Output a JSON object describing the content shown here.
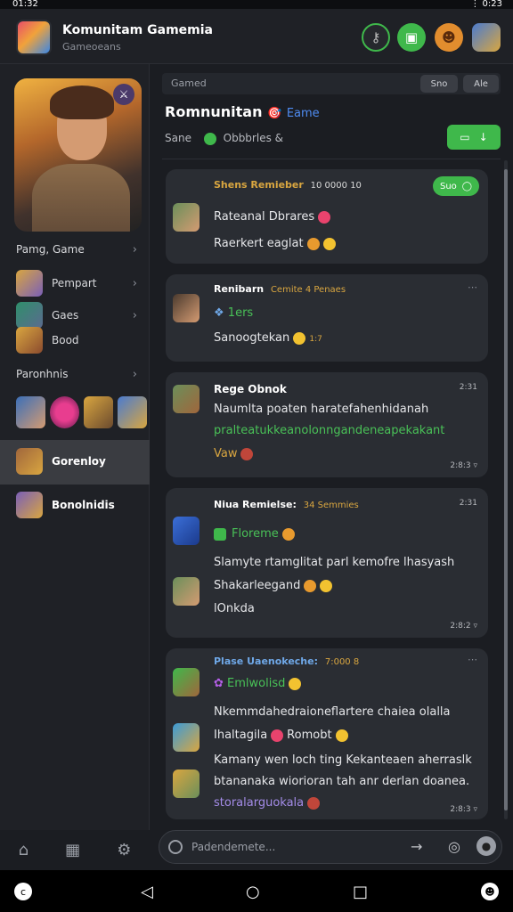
{
  "status": {
    "time": "01:32",
    "right": "⋮ 0:23"
  },
  "app": {
    "title": "Komunitam Gamemia",
    "subtitle": "Gameoeans"
  },
  "header_buttons": [
    "lock-icon",
    "video-icon",
    "face-icon",
    "avatar"
  ],
  "sidebar": {
    "rows": [
      {
        "label": "Pamg, Game",
        "chevron": true
      },
      {
        "label": "Pempart",
        "chevron": true
      },
      {
        "label": "Gaes",
        "chevron": true
      },
      {
        "label": "Bood",
        "chevron": false
      },
      {
        "label": "Paronhnis",
        "chevron": true
      },
      {
        "label": "Gorenloy"
      },
      {
        "label": "Bonolnidis"
      }
    ]
  },
  "main": {
    "search_label": "Gamed",
    "search_pill": "Sno",
    "search_pill2": "Ale",
    "title": "Romnunitan",
    "title_tag": "Eame",
    "subtitle": "Sane",
    "subtitle2": "Obbbrles &",
    "action": "",
    "composer_placeholder": "Padendemete..."
  },
  "messages": [
    {
      "head": "Shens Remieber",
      "meta": "10 0000 10",
      "lines": [
        "Rateanal Dbrares",
        "Raerkert eaglat"
      ],
      "pill": "Suo",
      "time": ""
    },
    {
      "head": "Renibarn",
      "meta": "Cemite 4 Penaes",
      "lines": [
        "1ers",
        "Sanoogtekan"
      ],
      "time": "1:7"
    },
    {
      "head": "Rege Obnok",
      "meta": "",
      "lines": [
        "Naumlta poaten haratefahenhidanah",
        "pralteatukkeanolonngandeneapekakant",
        "Vaw"
      ],
      "time": "2:31",
      "time2": "2:8:3"
    },
    {
      "head": "Niua Remielse:",
      "meta": "34 Semmies",
      "lines": [
        "Floreme",
        "Slamyte rtamglitat parl kemofre lhasyash",
        "Shakarleegand",
        "lOnkda"
      ],
      "time": "2:31",
      "time2": "2:8:2"
    },
    {
      "head": "Plase Uaenokeche:",
      "meta": "7:000 8",
      "lines": [
        "Emlwolisd",
        "Nkemmdahedraioneflartere chaiea olalla",
        "Ihaltagila",
        "Romobt",
        "Kamany wen loch ting Kekanteaen aherraslk",
        "btananaka wiorioran tah anr derlan doanea.",
        "storalarguokala"
      ],
      "time2": "2:8:3"
    }
  ]
}
